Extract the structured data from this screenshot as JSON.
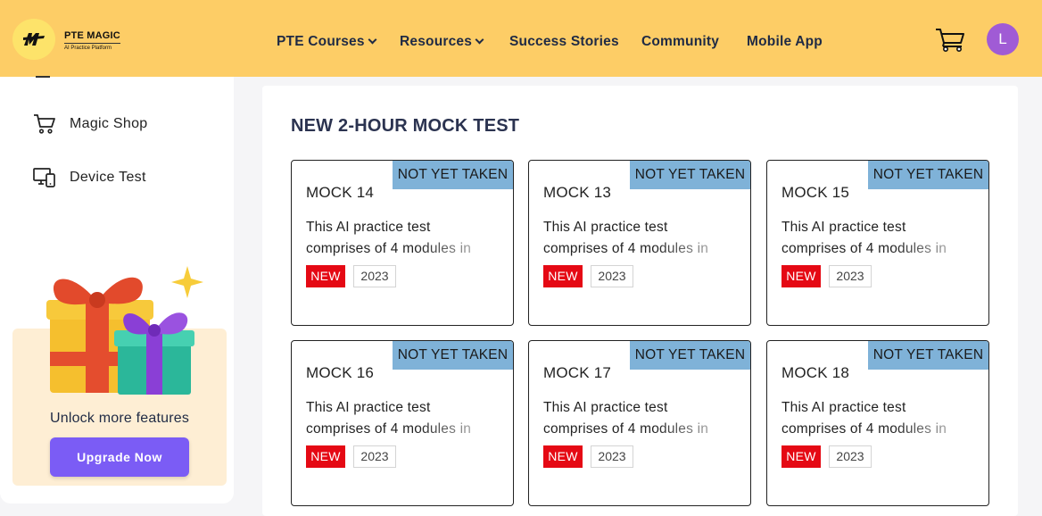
{
  "brand": {
    "name": "PTE MAGIC",
    "tagline": "AI Practice Platform"
  },
  "nav": {
    "courses": "PTE Courses",
    "resources": "Resources",
    "success": "Success Stories",
    "community": "Community",
    "mobile": "Mobile App"
  },
  "user": {
    "initial": "L"
  },
  "sidebar": {
    "items": [
      {
        "label": "Magic Shop",
        "icon": "shopping-cart-icon"
      },
      {
        "label": "Device Test",
        "icon": "device-icon"
      }
    ],
    "promo": {
      "text": "Unlock more features",
      "button": "Upgrade Now"
    }
  },
  "main": {
    "section_title": "NEW 2-HOUR MOCK TEST",
    "cards": [
      {
        "title": "MOCK 14",
        "status": "NOT YET TAKEN",
        "desc_line1": "This AI practice test",
        "desc_line2": "comprises of 4 modules in",
        "tag": "NEW",
        "year": "2023"
      },
      {
        "title": "MOCK 13",
        "status": "NOT YET TAKEN",
        "desc_line1": "This AI practice test",
        "desc_line2": "comprises of 4 modules in",
        "tag": "NEW",
        "year": "2023"
      },
      {
        "title": "MOCK 15",
        "status": "NOT YET TAKEN",
        "desc_line1": "This AI practice test",
        "desc_line2": "comprises of 4 modules in",
        "tag": "NEW",
        "year": "2023"
      },
      {
        "title": "MOCK 16",
        "status": "NOT YET TAKEN",
        "desc_line1": "This AI practice test",
        "desc_line2": "comprises of 4 modules in",
        "tag": "NEW",
        "year": "2023"
      },
      {
        "title": "MOCK 17",
        "status": "NOT YET TAKEN",
        "desc_line1": "This AI practice test",
        "desc_line2": "comprises of 4 modules in",
        "tag": "NEW",
        "year": "2023"
      },
      {
        "title": "MOCK 18",
        "status": "NOT YET TAKEN",
        "desc_line1": "This AI practice test",
        "desc_line2": "comprises of 4 modules in",
        "tag": "NEW",
        "year": "2023"
      }
    ]
  },
  "colors": {
    "header_bg": "#fdcd66",
    "status_bg": "#7fb2d8",
    "new_tag": "#e50914",
    "upgrade_button": "#7b5cf5",
    "avatar": "#a05bd5",
    "promo_bg": "#feeed4"
  }
}
